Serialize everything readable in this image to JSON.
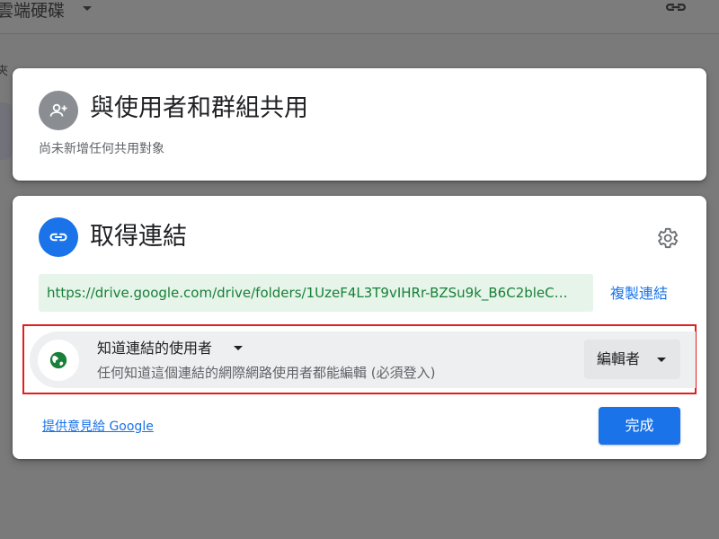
{
  "app": {
    "title": "雲端硬碟",
    "side_text": "夾"
  },
  "share_card": {
    "title": "與使用者和群組共用",
    "subtitle": "尚未新增任何共用對象"
  },
  "link_card": {
    "title": "取得連結",
    "url": "https://drive.google.com/drive/folders/1UzeF4L3T9vIHRr-BZSu9k_B6C2bleC…",
    "copy_label": "複製連結",
    "access": {
      "title": "知道連結的使用者",
      "description": "任何知道這個連結的網際網路使用者都能編輯 (必須登入)",
      "role": "編輯者"
    },
    "feedback_label": "提供意見給 Google",
    "done_label": "完成"
  },
  "colors": {
    "accent": "#1a73e8",
    "url_background": "#e6f4ea",
    "url_text": "#188038",
    "globe": "#188038",
    "highlight": "#e02020"
  },
  "icons": {
    "header_link": "link-icon",
    "share_avatar": "add-person-icon",
    "link_avatar": "link-icon",
    "settings": "gear-icon",
    "access": "globe-icon"
  }
}
